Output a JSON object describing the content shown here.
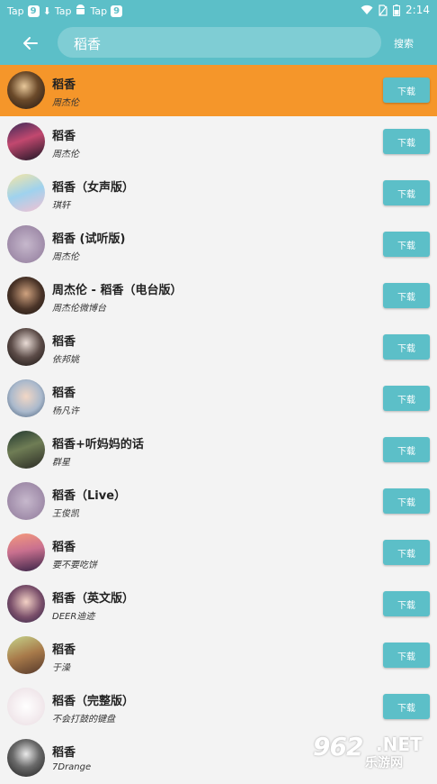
{
  "status_bar": {
    "left_items": [
      "Tap",
      "9",
      "Tap",
      "Tap",
      "9"
    ],
    "time": "2:14"
  },
  "search": {
    "value": "稻香",
    "button_label": "搜索"
  },
  "colors": {
    "accent": "#5cbfc8",
    "highlight": "#f5962a"
  },
  "songs": [
    {
      "title": "稻香",
      "artist": "周杰伦",
      "download_label": "下载"
    },
    {
      "title": "稻香",
      "artist": "周杰伦",
      "download_label": "下载"
    },
    {
      "title": "稻香（女声版）",
      "artist": "琪轩",
      "download_label": "下载"
    },
    {
      "title": "稻香 (试听版)",
      "artist": "周杰伦",
      "download_label": "下载"
    },
    {
      "title": "周杰伦 - 稻香（电台版）",
      "artist": "周杰伦微博台",
      "download_label": "下载"
    },
    {
      "title": "稻香",
      "artist": "依邦姚",
      "download_label": "下载"
    },
    {
      "title": "稻香",
      "artist": "杨凡许",
      "download_label": "下载"
    },
    {
      "title": "稻香+听妈妈的话",
      "artist": "群星",
      "download_label": "下载"
    },
    {
      "title": "稻香（Live）",
      "artist": "王俊凯",
      "download_label": "下载"
    },
    {
      "title": "稻香",
      "artist": "要不要吃饼",
      "download_label": "下载"
    },
    {
      "title": "稻香（英文版）",
      "artist": "DEER迪迹",
      "download_label": "下载"
    },
    {
      "title": "稻香",
      "artist": "于澡",
      "download_label": "下载"
    },
    {
      "title": "稻香（完整版）",
      "artist": "不会打鼓的键盘",
      "download_label": "下载"
    },
    {
      "title": "稻香",
      "artist": "7Drange",
      "download_label": ""
    }
  ],
  "watermark": {
    "number": "962",
    "net": ".NET",
    "site": "乐游网"
  }
}
